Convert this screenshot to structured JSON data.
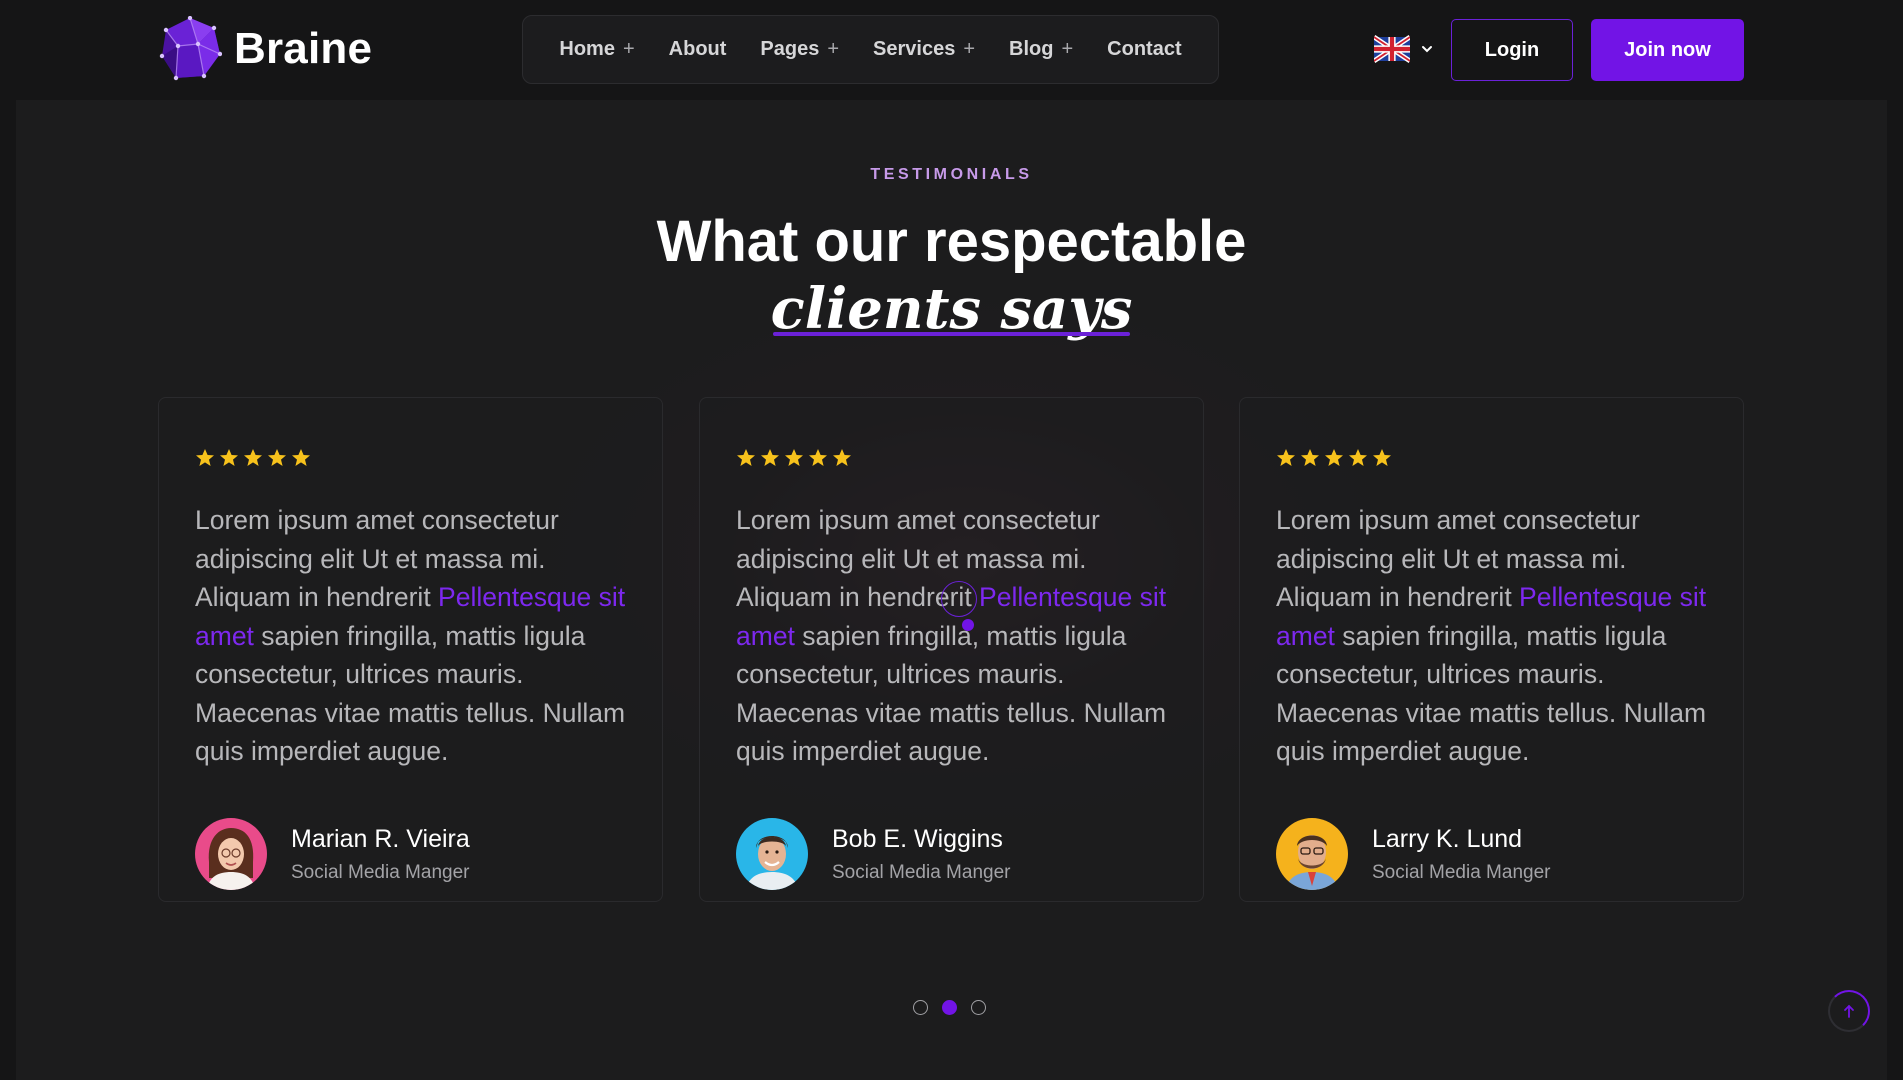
{
  "brand": {
    "name": "Braine",
    "accent": "#7214e6"
  },
  "nav": {
    "items": [
      {
        "label": "Home",
        "has_submenu": true
      },
      {
        "label": "About",
        "has_submenu": false
      },
      {
        "label": "Pages",
        "has_submenu": true
      },
      {
        "label": "Services",
        "has_submenu": true
      },
      {
        "label": "Blog",
        "has_submenu": true
      },
      {
        "label": "Contact",
        "has_submenu": false
      }
    ],
    "plus_symbol": "+"
  },
  "language": {
    "icon": "uk-flag-icon"
  },
  "header": {
    "login_label": "Login",
    "join_label": "Join now"
  },
  "section": {
    "eyebrow": "TESTIMONIALS",
    "headline_line1": "What our respectable",
    "headline_line2": "clients says"
  },
  "testimonials": [
    {
      "rating": 5,
      "quote_before": "Lorem ipsum amet consectetur adipiscing elit Ut et massa mi. Aliquam in hendrerit ",
      "quote_highlight": "Pellentesque sit amet",
      "quote_after": " sapien fringilla, mattis ligula consectetur, ultrices mauris. Maecenas vitae mattis tellus. Nullam quis imperdiet augue.",
      "name": "Marian R. Vieira",
      "role": "Social Media Manger",
      "avatar_bg": "#e94b8a"
    },
    {
      "rating": 5,
      "quote_before": "Lorem ipsum amet consectetur adipiscing elit Ut et massa mi. Aliquam in hendrerit ",
      "quote_highlight": "Pellentesque sit amet",
      "quote_after": " sapien fringilla, mattis ligula consectetur, ultrices mauris. Maecenas vitae mattis tellus. Nullam quis imperdiet augue.",
      "name": "Bob E. Wiggins",
      "role": "Social Media Manger",
      "avatar_bg": "#29b6e8"
    },
    {
      "rating": 5,
      "quote_before": "Lorem ipsum amet consectetur adipiscing elit Ut et massa mi. Aliquam in hendrerit ",
      "quote_highlight": "Pellentesque sit amet",
      "quote_after": " sapien fringilla, mattis ligula consectetur, ultrices mauris. Maecenas vitae mattis tellus. Nullam quis imperdiet augue.",
      "name": "Larry K. Lund",
      "role": "Social Media Manger",
      "avatar_bg": "#f5b21c"
    }
  ],
  "pagination": {
    "count": 3,
    "active": 2
  },
  "star_color": "#f7c21c"
}
